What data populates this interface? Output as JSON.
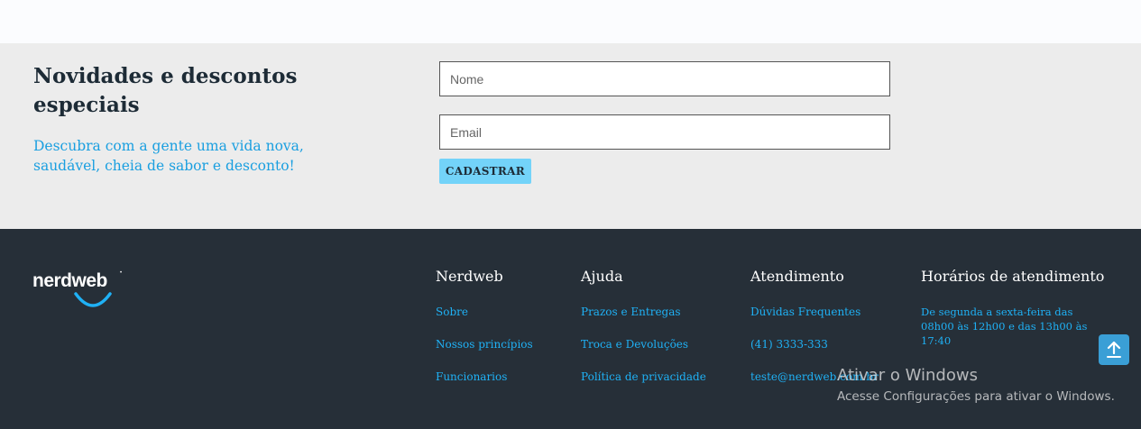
{
  "newsletter": {
    "title": "Novidades e descontos especiais",
    "description": "Descubra com a gente uma vida nova, saudável, cheia de sabor e desconto!",
    "name_placeholder": "Nome",
    "email_placeholder": "Email",
    "submit_label": "CADASTRAR"
  },
  "footer": {
    "logo_text": "nerdweb",
    "columns": [
      {
        "title": "Nerdweb",
        "links": [
          "Sobre",
          "Nossos princípios",
          "Funcionarios"
        ]
      },
      {
        "title": "Ajuda",
        "links": [
          "Prazos e Entregas",
          "Troca e Devoluções",
          "Política de privacidade"
        ]
      },
      {
        "title": "Atendimento",
        "links": [
          "Dúvidas Frequentes",
          "(41) 3333-333",
          "teste@nerdweb.com.br"
        ]
      },
      {
        "title": "Horários de atendimento",
        "text": "De segunda a sexta-feira das 08h00 às 12h00 e das 13h00 às 17:40"
      }
    ]
  },
  "scroll_top_icon": "arrow-up-icon",
  "watermark": {
    "title": "Ativar o Windows",
    "subtitle": "Acesse Configurações para ativar o Windows."
  },
  "colors": {
    "accent": "#1fb1f5",
    "button": "#73d3f9",
    "footer_bg": "#262f38",
    "newsletter_bg": "#ececec"
  }
}
